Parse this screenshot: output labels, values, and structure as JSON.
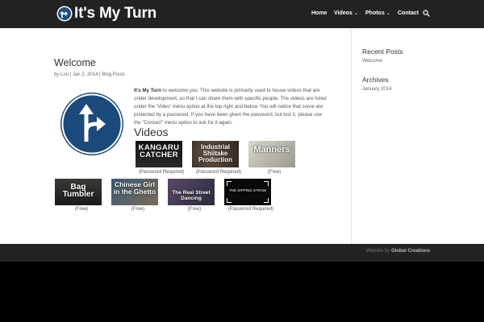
{
  "header": {
    "site_title": "It's My Turn",
    "nav": [
      {
        "label": "Home",
        "has_dropdown": false
      },
      {
        "label": "Videos",
        "has_dropdown": true
      },
      {
        "label": "Photos",
        "has_dropdown": true
      },
      {
        "label": "Contact",
        "has_dropdown": false
      }
    ],
    "search_icon": "search-icon"
  },
  "post": {
    "title": "Welcome",
    "meta_prefix": "by",
    "author": "Lou",
    "separator": "|",
    "date": "Jan 2, 2014",
    "category": "Blog Posts",
    "intro_bold": "It's My Turn",
    "intro_text": " to welcome you.  This website is primarily used to house videos that are under development, so that I can share them with specific people.  The videos are listed under the 'Video' menu option at the top right and below.  You will notice that some are protected by a password.  If you have been given the password, but lost it, please use the \"Contact\" menu option to ask for it again.",
    "videos_heading": "Videos",
    "videos": [
      {
        "title": "KANGARU CATCHER",
        "caption": "(Password Required)"
      },
      {
        "title": "Industrial Shiitake Production",
        "caption": "(Password Required)"
      },
      {
        "title": "Manners",
        "caption": "(Free)"
      },
      {
        "title": "Bag Tumbler",
        "caption": "(Free)"
      },
      {
        "title": "Chinese Girl in the Ghetto",
        "caption": "(Free)"
      },
      {
        "title": "The Real Street Dancing",
        "caption": "(Free)"
      },
      {
        "title": "THE SIPPING STRAW",
        "caption": "(Password Required)"
      }
    ]
  },
  "sidebar": {
    "recent_posts_heading": "Recent Posts",
    "recent_posts": [
      "Welcome"
    ],
    "archives_heading": "Archives",
    "archives": [
      "January 2014"
    ]
  },
  "footer": {
    "prefix": "Website by ",
    "credit": "Global Creations"
  },
  "colors": {
    "header_bg": "#222222",
    "logo_blue": "#1f4e79",
    "sign_blue": "#1b4a7a",
    "footer_bg": "#222222"
  }
}
